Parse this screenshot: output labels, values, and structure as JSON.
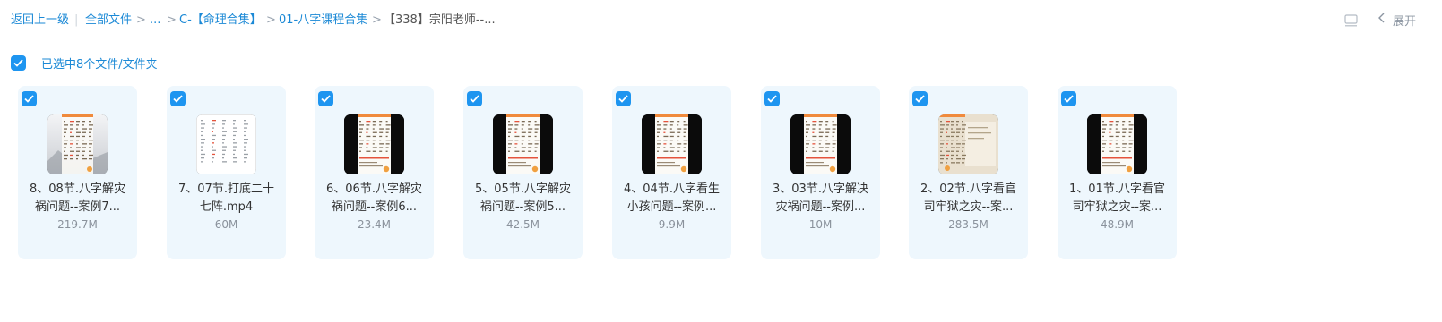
{
  "breadcrumb": {
    "back": "返回上一级",
    "all_files": "全部文件",
    "ellipsis": "...",
    "folder1": "C-【命理合集】",
    "folder2": "01-八字课程合集",
    "current": "【338】宗阳老师--..."
  },
  "header": {
    "expand_label": "展开",
    "panel_icon": "panel-icon",
    "collapse_icon": "chevron-left-icon"
  },
  "selection": {
    "text": "已选中8个文件/文件夹",
    "checked": true
  },
  "colors": {
    "accent": "#1e95f0",
    "link": "#1b89d6",
    "tile_bg": "#eef7fd"
  },
  "files": [
    {
      "line1": "8、08节.八字解灾",
      "line2": "祸问题--案例7...",
      "size": "219.7M",
      "thumb": "landscape-doc"
    },
    {
      "line1": "7、07节.打底二十",
      "line2": "七阵.mp4",
      "size": "60M",
      "thumb": "white-doc"
    },
    {
      "line1": "6、06节.八字解灾",
      "line2": "祸问题--案例6...",
      "size": "23.4M",
      "thumb": "phone-doc"
    },
    {
      "line1": "5、05节.八字解灾",
      "line2": "祸问题--案例5...",
      "size": "42.5M",
      "thumb": "phone-doc"
    },
    {
      "line1": "4、04节.八字看生",
      "line2": "小孩问题--案例...",
      "size": "9.9M",
      "thumb": "phone-doc"
    },
    {
      "line1": "3、03节.八字解决",
      "line2": "灾祸问题--案例...",
      "size": "10M",
      "thumb": "phone-doc"
    },
    {
      "line1": "2、02节.八字看官",
      "line2": "司牢狱之灾--案...",
      "size": "283.5M",
      "thumb": "paper-doc"
    },
    {
      "line1": "1、01节.八字看官",
      "line2": "司牢狱之灾--案...",
      "size": "48.9M",
      "thumb": "phone-doc"
    }
  ]
}
